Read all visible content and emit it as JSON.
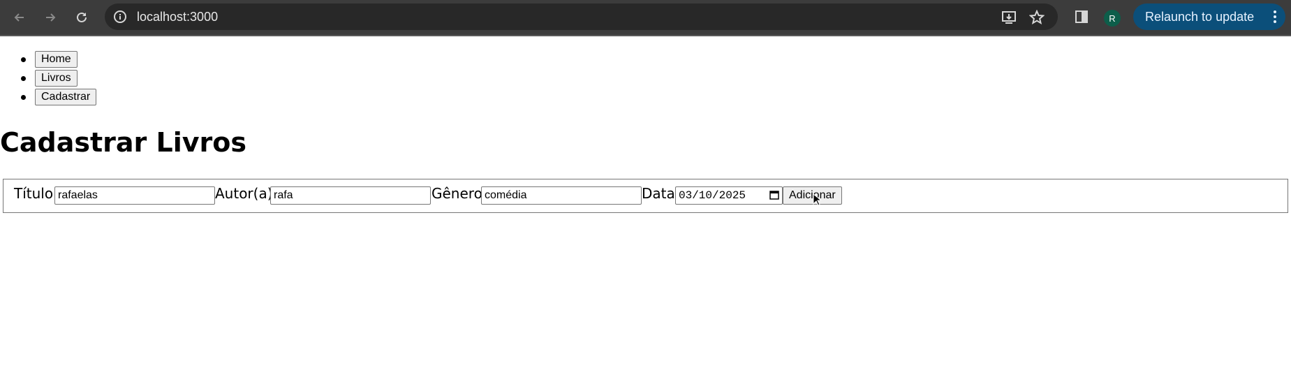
{
  "browser": {
    "url": "localhost:3000",
    "relaunch_label": "Relaunch to update",
    "profile_initial": "R",
    "icons": [
      "back-arrow-icon",
      "forward-arrow-icon",
      "reload-icon",
      "site-info-icon",
      "install-app-icon",
      "bookmark-star-icon",
      "side-panel-icon",
      "more-vert-icon"
    ],
    "colors": {
      "chrome": "#3c3c3c",
      "omnibox": "#282828",
      "relaunch": "#0b4f7a",
      "avatar": "#0d5e4a"
    }
  },
  "nav": {
    "items": [
      "Home",
      "Livros",
      "Cadastrar"
    ]
  },
  "page": {
    "title": "Cadastrar Livros"
  },
  "form": {
    "titulo_label": "Título:",
    "titulo_value": "rafaelas",
    "autor_label": "Autor(a):",
    "autor_value": "rafa",
    "genero_label": "Gênero:",
    "genero_value": "comédia",
    "data_label": "Data:",
    "data_value": "03/10/2025",
    "submit_label": "Adicionar"
  }
}
